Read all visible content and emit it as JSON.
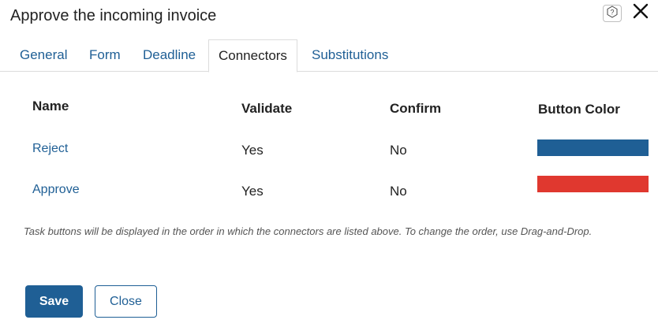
{
  "dialog": {
    "title": "Approve the incoming invoice",
    "help_icon": "question-mark-icon",
    "close_icon": "close-icon"
  },
  "tabs": [
    {
      "label": "General",
      "active": false
    },
    {
      "label": "Form",
      "active": false
    },
    {
      "label": "Deadline",
      "active": false
    },
    {
      "label": "Connectors",
      "active": true
    },
    {
      "label": "Substitutions",
      "active": false
    }
  ],
  "table": {
    "columns": [
      "Name",
      "Validate",
      "Confirm",
      "Button Color"
    ],
    "rows": [
      {
        "name": "Reject",
        "validate": "Yes",
        "confirm": "No",
        "color": "#1f5f95"
      },
      {
        "name": "Approve",
        "validate": "Yes",
        "confirm": "No",
        "color": "#e0382f"
      }
    ]
  },
  "hint": "Task buttons will be displayed in the order in which the connectors are listed above. To change the order, use Drag-and-Drop.",
  "footer": {
    "save_label": "Save",
    "close_label": "Close"
  }
}
